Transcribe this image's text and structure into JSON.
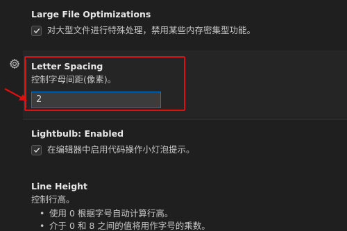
{
  "settings": {
    "large_file": {
      "title": "Large File Optimizations",
      "checkbox_label": "对大型文件进行特殊处理，禁用某些内存密集型功能。",
      "checked": true
    },
    "letter_spacing": {
      "title": "Letter Spacing",
      "description": "控制字母间距(像素)。",
      "value": "2"
    },
    "lightbulb": {
      "category": "Lightbulb: ",
      "title": "Enabled",
      "checkbox_label": "在编辑器中启用代码操作小灯泡提示。",
      "checked": true
    },
    "line_height": {
      "title": "Line Height",
      "description": "控制行高。",
      "bullets": [
        "使用 0 根据字号自动计算行高。",
        "介于 0 和 8 之间的值将用作字号的乘数。"
      ]
    }
  },
  "colors": {
    "background": "#1f1f1f",
    "focused_background": "#252526",
    "accent": "#0078d4",
    "annotation_red": "#e01010"
  },
  "icons": {
    "gear": "gear-icon",
    "check": "check-icon",
    "arrow": "red-arrow-annotation"
  }
}
